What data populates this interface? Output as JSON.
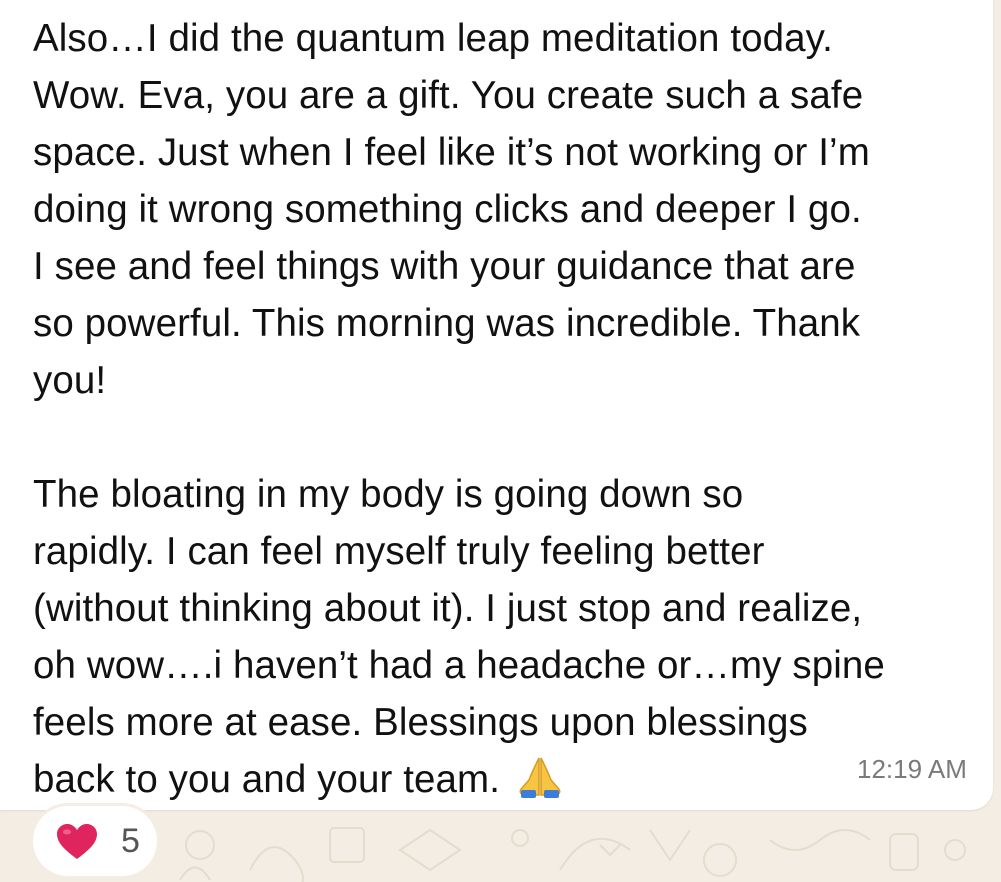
{
  "message": {
    "lines": [
      "Also…I did the quantum leap meditation today.",
      "Wow. Eva, you are a gift. You create such a safe",
      "space. Just when I feel like it’s not working or I’m",
      "doing it wrong something clicks and deeper I go.",
      "I see and feel things with your guidance that are",
      "so powerful. This morning was incredible. Thank",
      "you!",
      "",
      "The bloating in my body is going down so",
      "rapidly. I can feel myself truly feeling better",
      "(without thinking about it). I just stop and realize,",
      "oh wow….i haven’t had a headache or…my spine",
      "feels more at ease. Blessings upon blessings",
      "back to you and your team."
    ],
    "emoji": "folded-hands-emoji",
    "timestamp": "12:19 AM"
  },
  "reaction": {
    "emoji": "red-heart-emoji",
    "count": "5"
  },
  "colors": {
    "bubble": "#ffffff",
    "background": "#f3ede3",
    "text": "#111111",
    "timestamp": "#7a7a7a",
    "heart": "#e0245e"
  }
}
